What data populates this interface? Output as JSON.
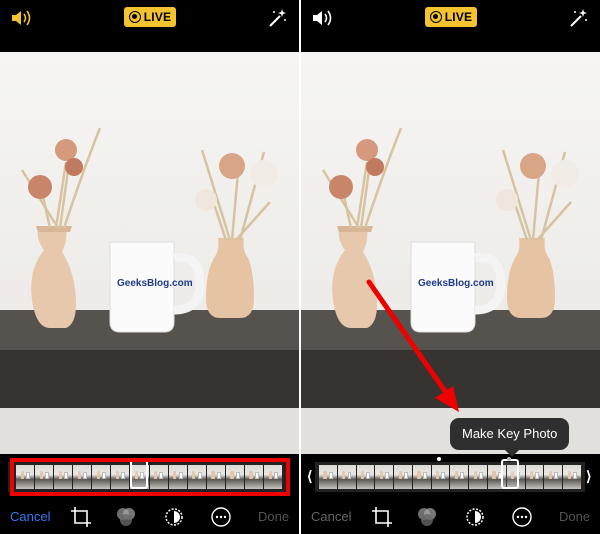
{
  "left_panel": {
    "live_label": "LIVE",
    "photo_text": "GeeksBlog.com",
    "bottom": {
      "cancel_label": "Cancel",
      "done_label": "Done"
    }
  },
  "right_panel": {
    "live_label": "LIVE",
    "photo_text": "GeeksBlog.com",
    "tooltip": "Make Key Photo",
    "bottom": {
      "cancel_label": "Cancel",
      "done_label": "Done"
    }
  },
  "icons": [
    "speaker-icon",
    "live-icon",
    "magic-wand-icon",
    "crop-icon",
    "filters-icon",
    "adjust-icon",
    "more-icon",
    "chevron-left-icon",
    "chevron-right-icon"
  ],
  "colors": {
    "live": "#f4c430",
    "cancel_active": "#2f7bf6",
    "highlight": "#e00000",
    "arrow": "#e00000"
  }
}
